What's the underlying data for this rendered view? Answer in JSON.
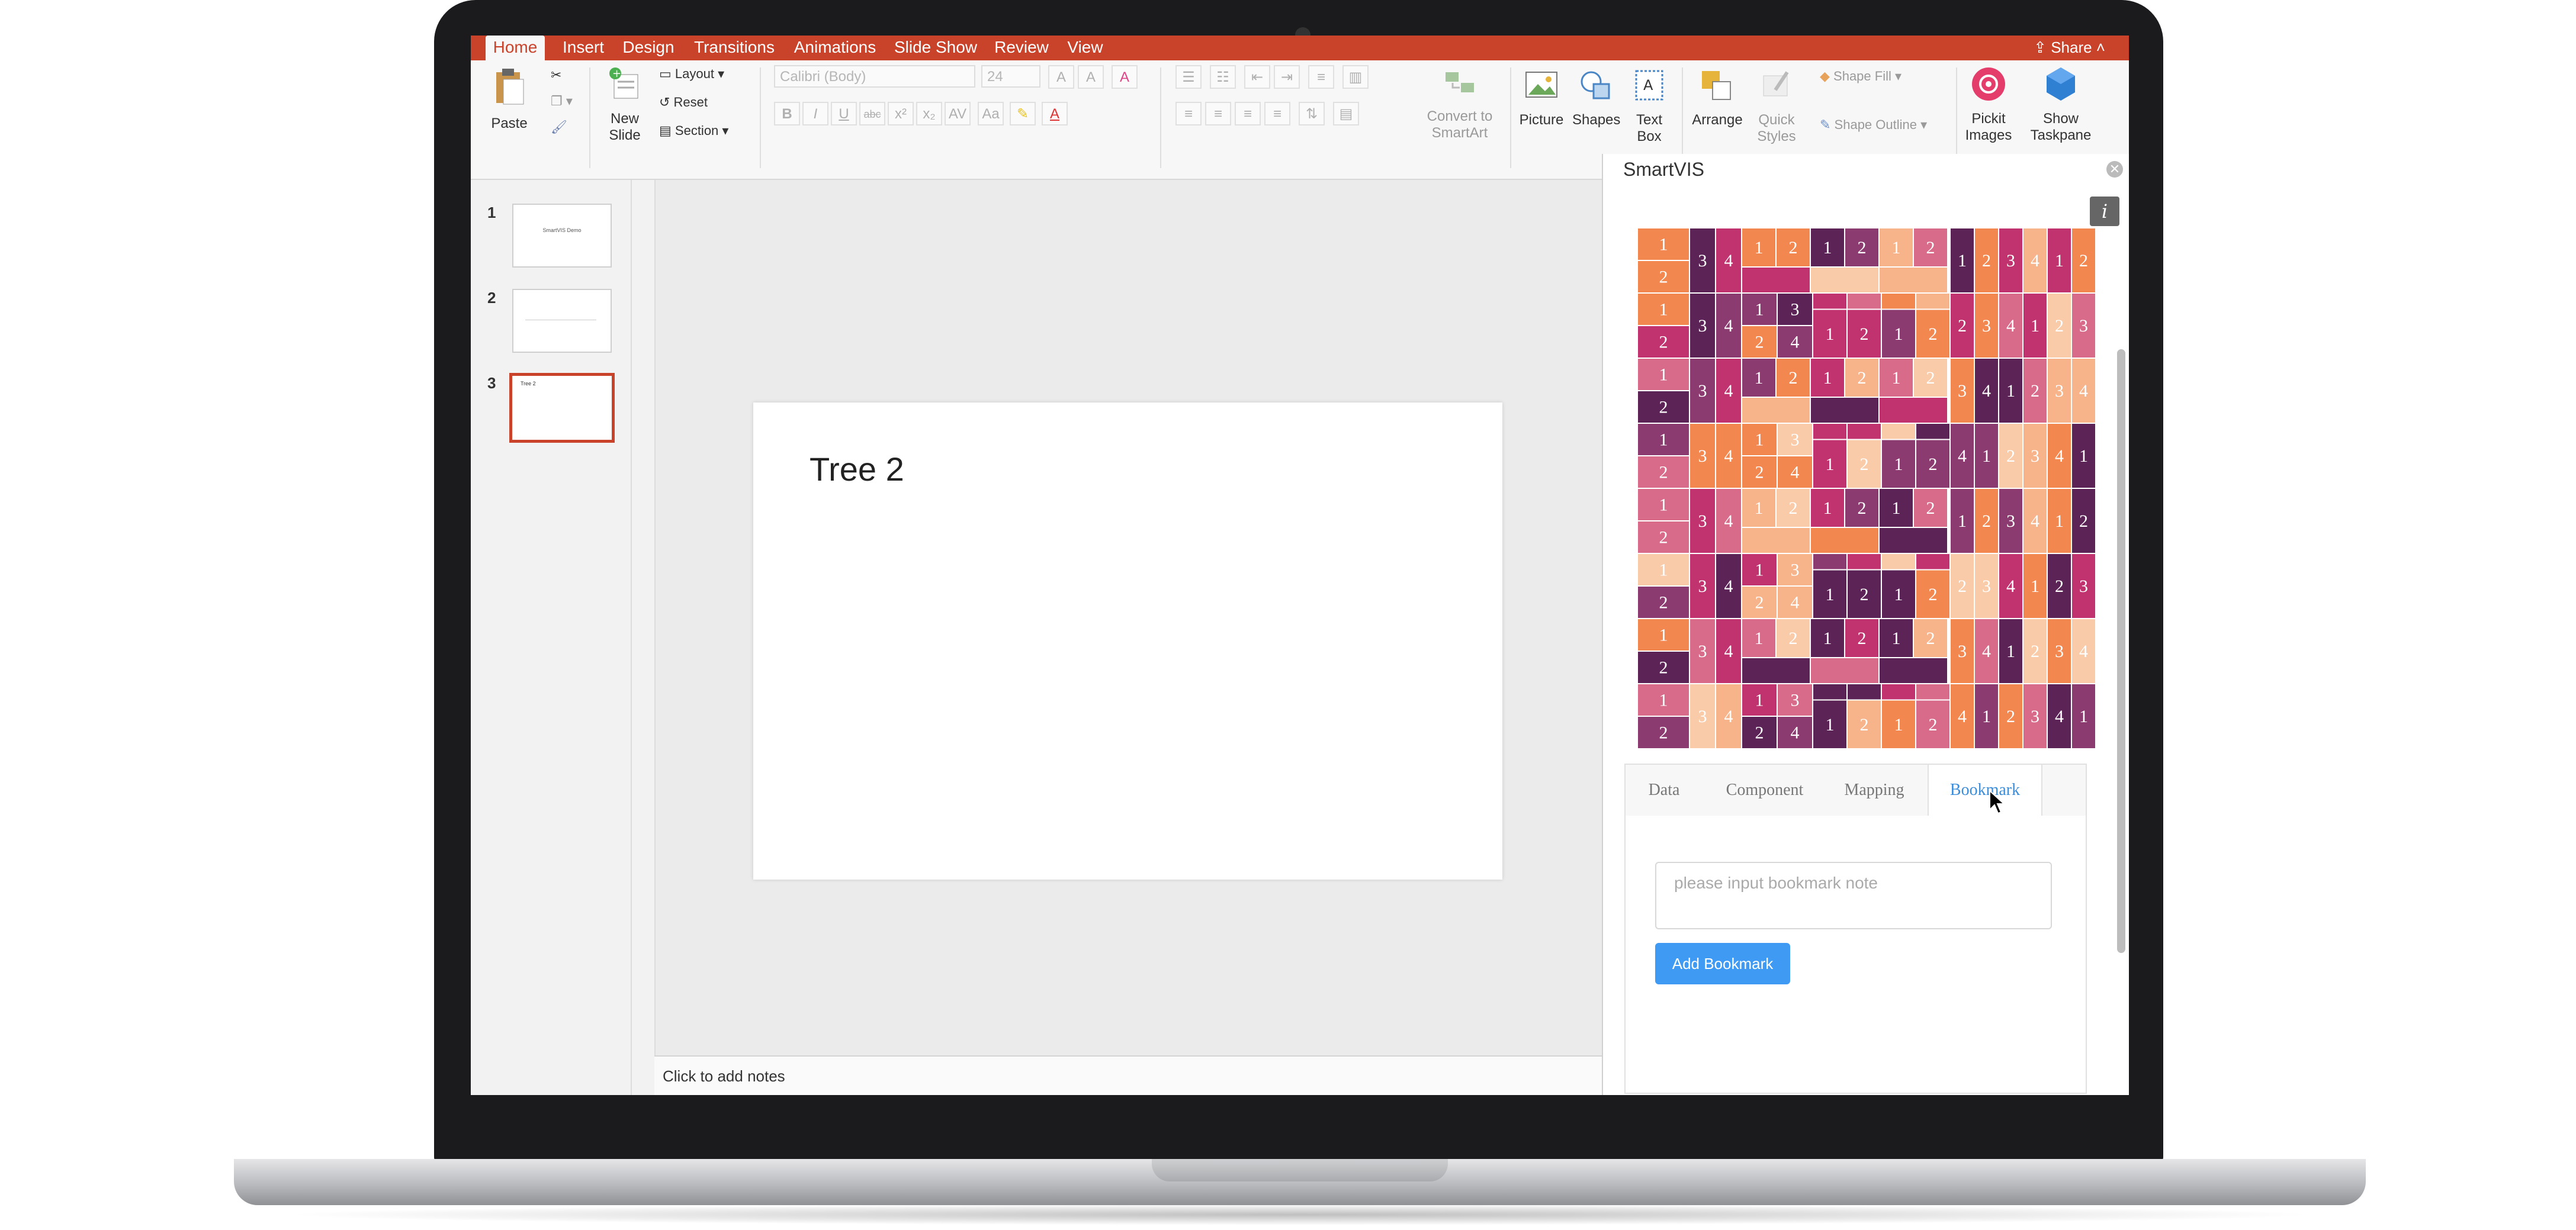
{
  "ribbon": {
    "tabs": [
      "Home",
      "Insert",
      "Design",
      "Transitions",
      "Animations",
      "Slide Show",
      "Review",
      "View"
    ],
    "active_tab": "Home",
    "share_label": "Share",
    "paste_label": "Paste",
    "new_slide_label": "New Slide",
    "layout_label": "Layout",
    "reset_label": "Reset",
    "section_label": "Section",
    "font_name": "Calibri (Body)",
    "font_size": "24",
    "convert_smartart_label": "Convert to SmartArt",
    "picture_label": "Picture",
    "shapes_label": "Shapes",
    "textbox_label": "Text Box",
    "arrange_label": "Arrange",
    "quick_styles_label": "Quick Styles",
    "shape_fill_label": "Shape Fill",
    "shape_outline_label": "Shape Outline",
    "pickit_label": "Pickit Images",
    "show_taskpane_label": "Show Taskpane",
    "accent_color": "#c9432b"
  },
  "slides": {
    "numbers": [
      "1",
      "2",
      "3"
    ],
    "thumb_texts": [
      "SmartVIS Demo",
      "",
      "Tree 2"
    ],
    "selected": "3"
  },
  "slide": {
    "title": "Tree 2"
  },
  "notes": {
    "placeholder": "Click to add notes"
  },
  "taskpane": {
    "title": "SmartVIS",
    "info_icon": "i",
    "tabs": [
      "Data",
      "Component",
      "Mapping",
      "Bookmark"
    ],
    "active_tab": "Bookmark",
    "bookmark_placeholder": "please input bookmark note",
    "add_bookmark_label": "Add Bookmark",
    "treemap_palette": [
      "#5c2456",
      "#c0336e",
      "#d86a8a",
      "#f2874f",
      "#f7b48a",
      "#f9cba8",
      "#8c3b70"
    ],
    "treemap_labels": [
      "1",
      "2",
      "3",
      "4"
    ]
  }
}
